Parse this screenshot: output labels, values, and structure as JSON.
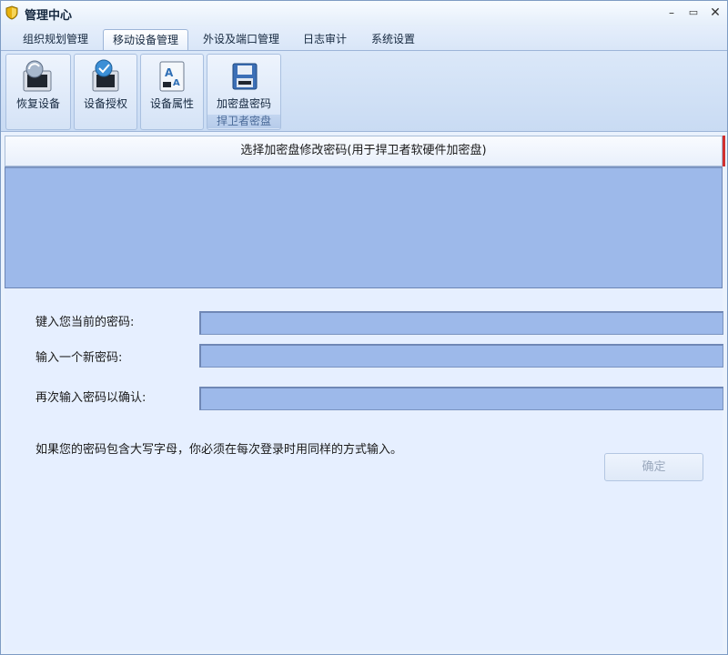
{
  "window": {
    "title": "管理中心",
    "min_symbol": "–",
    "max_symbol": "▭",
    "close_symbol": "✕"
  },
  "tabs": [
    {
      "label": "组织规划管理",
      "active": false
    },
    {
      "label": "移动设备管理",
      "active": true
    },
    {
      "label": "外设及端口管理",
      "active": false
    },
    {
      "label": "日志审计",
      "active": false
    },
    {
      "label": "系统设置",
      "active": false
    }
  ],
  "ribbon": {
    "buttons": [
      {
        "label": "恢复设备",
        "icon": "device-restore-icon"
      },
      {
        "label": "设备授权",
        "icon": "device-authorize-icon"
      },
      {
        "label": "设备属性",
        "icon": "device-properties-icon"
      },
      {
        "label": "加密盘密码",
        "icon": "encrypted-disk-password-icon"
      }
    ],
    "group_label": "捍卫者密盘"
  },
  "main": {
    "list_header": "选择加密盘修改密码(用于捍卫者软硬件加密盘)",
    "current_password_label": "键入您当前的密码:",
    "current_password_value": "",
    "new_password_label": "输入一个新密码:",
    "new_password_value": "",
    "confirm_password_label": "再次输入密码以确认:",
    "confirm_password_value": "",
    "hint": "如果您的密码包含大写字母，你必须在每次登录时用同样的方式输入。",
    "ok_label": "确定"
  },
  "colors": {
    "accent": "#9db9ea",
    "window_bg": "#eaf2fd",
    "disabled_text": "#9aa8bd"
  }
}
